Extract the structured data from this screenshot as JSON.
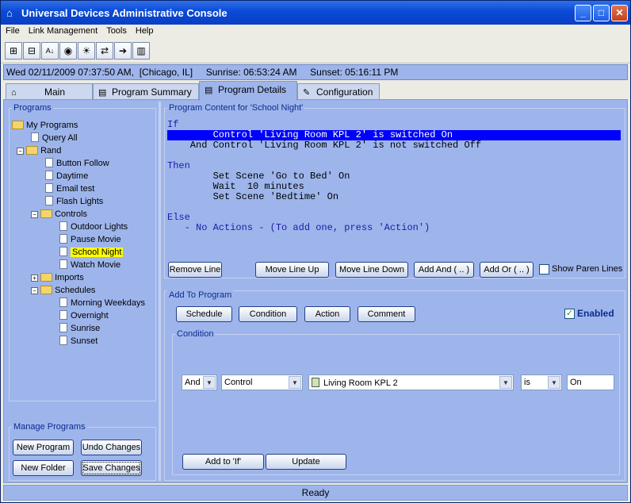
{
  "window": {
    "title": "Universal Devices Administrative Console",
    "min_label": "_",
    "max_label": "□",
    "close_label": "✕"
  },
  "menu": [
    "File",
    "Link Management",
    "Tools",
    "Help"
  ],
  "toolbar_icons": [
    "expand-all-icon",
    "collapse-all-icon",
    "sort-az-icon",
    "globe-icon",
    "light-bulb-icon",
    "link-icon",
    "arrow-right-icon",
    "chart-icon"
  ],
  "status_line": {
    "datetime": "Wed 02/11/2009 07:37:50 AM,",
    "location": "[Chicago, IL]",
    "sunrise": "Sunrise: 06:53:24 AM",
    "sunset": "Sunset: 05:16:11 PM"
  },
  "tabs": [
    {
      "label": "Main"
    },
    {
      "label": "Program Summary"
    },
    {
      "label": "Program Details"
    },
    {
      "label": "Configuration"
    }
  ],
  "programs_panel": {
    "title": "Programs",
    "items": {
      "my_programs": "My Programs",
      "query_all": "Query All",
      "rand": "Rand",
      "button_follow": "Button Follow",
      "daytime": "Daytime",
      "email_test": "Email test",
      "flash_lights": "Flash Lights",
      "controls": "Controls",
      "outdoor_lights": "Outdoor Lights",
      "pause_movie": "Pause Movie",
      "school_night": "School Night",
      "watch_movie": "Watch Movie",
      "imports": "Imports",
      "schedules": "Schedules",
      "morning_weekdays": "Morning Weekdays",
      "overnight": "Overnight",
      "sunrise": "Sunrise",
      "sunset": "Sunset"
    }
  },
  "manage": {
    "title": "Manage Programs",
    "new_program": "New Program",
    "undo_changes": "Undo Changes",
    "new_folder": "New Folder",
    "save_changes": "Save Changes"
  },
  "program_content": {
    "title": "Program Content for 'School Night'",
    "if_label": "If",
    "if_line1": "        Control 'Living Room KPL 2' is switched On",
    "if_line2": "    And Control 'Living Room KPL 2' is not switched Off",
    "then_label": "Then",
    "then_line1": "        Set Scene 'Go to Bed' On",
    "then_line2": "        Wait  10 minutes",
    "then_line3": "        Set Scene 'Bedtime' On",
    "else_label": "Else",
    "else_line1": "   - No Actions - (To add one, press 'Action')",
    "remove_line": "Remove Line",
    "move_up": "Move Line Up",
    "move_down": "Move Line Down",
    "add_and": "Add And ( .. )",
    "add_or": "Add Or ( .. )",
    "show_paren": "Show Paren Lines"
  },
  "add_to_program": {
    "title": "Add To Program",
    "schedule": "Schedule",
    "condition": "Condition",
    "action": "Action",
    "comment": "Comment",
    "enabled": "Enabled"
  },
  "condition": {
    "title": "Condition",
    "op": "And",
    "type": "Control",
    "device": "Living Room KPL 2",
    "comparator": "is",
    "value": "On",
    "add_to_if": "Add to 'If'",
    "update": "Update"
  },
  "status_bar": "Ready",
  "colors": {
    "panel_bg": "#9eb5ec",
    "selection": "#0000ff",
    "highlight": "#ffff00",
    "title_blue": "#0a4ad6"
  }
}
